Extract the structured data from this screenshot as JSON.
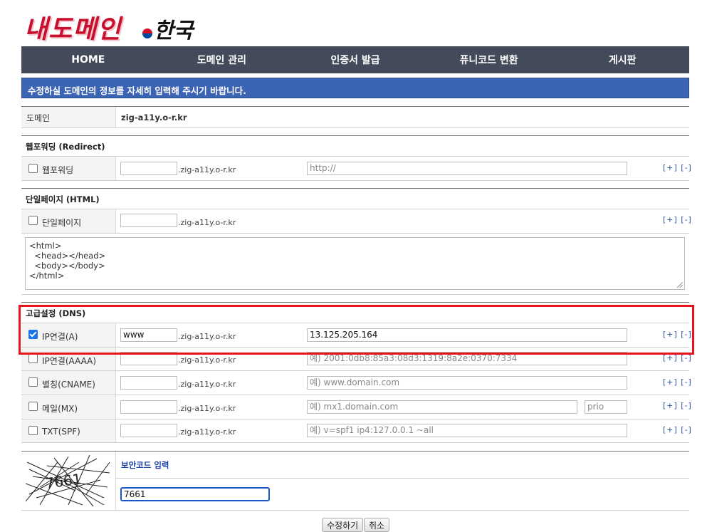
{
  "logo": {
    "main": "내도메인",
    "sub": "한국"
  },
  "nav": [
    "HOME",
    "도메인 관리",
    "인증서 발급",
    "퓨니코드 변환",
    "게시판"
  ],
  "notice": "수정하실 도메인의 정보를 자세히 입력해 주시기 바랍니다.",
  "domain": {
    "label": "도메인",
    "value": "zig-a11y.o-r.kr"
  },
  "suffix": ".zig-a11y.o-r.kr",
  "plus_minus": "[+] [-]",
  "redirect": {
    "title": "웹포워딩 (Redirect)",
    "checkbox_label": "웹포워딩",
    "url_placeholder": "http://"
  },
  "html_page": {
    "title": "단일페이지 (HTML)",
    "checkbox_label": "단일페이지",
    "content": [
      "<html>",
      "  <head></head>",
      "  <body></body>",
      "</html>"
    ]
  },
  "dns": {
    "title": "고급설정 (DNS)",
    "records": [
      {
        "label": "IP연결(A)",
        "checked": true,
        "host": "www",
        "value": "13.125.205.164",
        "placeholder": ""
      },
      {
        "label": "IP연결(AAAA)",
        "checked": false,
        "host": "",
        "value": "",
        "placeholder": "예) 2001:0db8:85a3:08d3:1319:8a2e:0370:7334"
      },
      {
        "label": "별칭(CNAME)",
        "checked": false,
        "host": "",
        "value": "",
        "placeholder": "예) www.domain.com"
      },
      {
        "label": "메일(MX)",
        "checked": false,
        "host": "",
        "value": "",
        "placeholder": "예) mx1.domain.com",
        "prio_placeholder": "prio"
      },
      {
        "label": "TXT(SPF)",
        "checked": false,
        "host": "",
        "value": "",
        "placeholder": "예) v=spf1 ip4:127.0.0.1 ~all"
      }
    ]
  },
  "captcha": {
    "label": "보안코드 입력",
    "code": "7661",
    "input_value": "7661"
  },
  "buttons": {
    "submit": "수정하기",
    "cancel": "취소"
  }
}
